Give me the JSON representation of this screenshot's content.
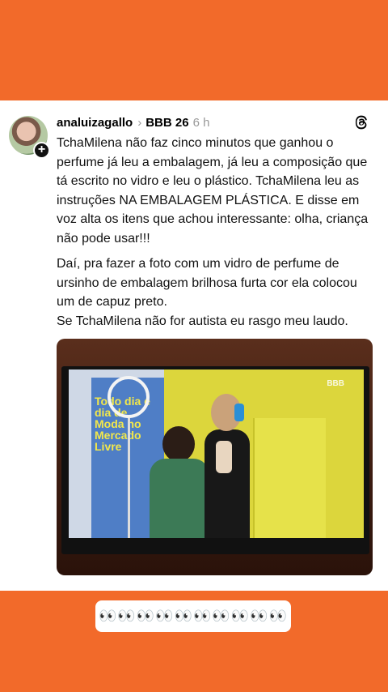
{
  "post": {
    "username": "analuizagallo",
    "topic": "BBB 26",
    "time": "6 h",
    "paragraph1": "TchaMilena não faz cinco minutos que ganhou o perfume já leu a embalagem, já leu a composição que tá escrito no vidro e leu o plástico. TchaMilena leu as instruções NA EMBALAGEM PLÁSTICA. E disse em voz alta os itens que achou interessante: olha, criança não pode usar!!!",
    "paragraph2": "Daí, pra fazer a foto com um vidro de perfume de ursinho de embalagem brilhosa furta cor ela colocou um de capuz preto.",
    "paragraph3": "Se TchaMilena não for autista eu rasgo meu laudo.",
    "media": {
      "banner_text": "Todo dia é dia de Moda no Mercado Livre",
      "channel_logo": "BBB"
    }
  },
  "bottom": {
    "emojis": "👀👀👀👀👀👀👀👀👀👀"
  },
  "colors": {
    "background": "#f26a2a",
    "card": "#ffffff"
  },
  "icons": {
    "avatar_badge": "plus-icon",
    "app": "threads-icon",
    "separator": "chevron-right-icon"
  }
}
